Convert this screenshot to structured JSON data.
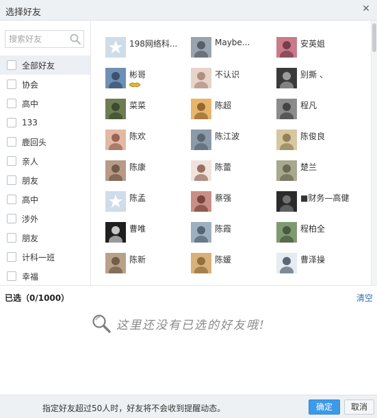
{
  "dialog": {
    "title": "选择好友",
    "close_glyph": "✕"
  },
  "search": {
    "placeholder": "搜索好友",
    "icon": "search-icon"
  },
  "groups": [
    {
      "label": "全部好友",
      "active": true
    },
    {
      "label": "协会"
    },
    {
      "label": "高中"
    },
    {
      "label": "133"
    },
    {
      "label": "鹿回头"
    },
    {
      "label": "亲人"
    },
    {
      "label": "朋友"
    },
    {
      "label": "高中"
    },
    {
      "label": "涉外"
    },
    {
      "label": "朋友"
    },
    {
      "label": "计科一班"
    },
    {
      "label": "幸福"
    }
  ],
  "friends": [
    {
      "name": "198网络科...",
      "avatar": "default-star-avatar"
    },
    {
      "name": "Maybe...",
      "avatar": "photo-avatar"
    },
    {
      "name": "安英姐",
      "avatar": "photo-avatar"
    },
    {
      "name": "彬哥",
      "avatar": "photo-avatar",
      "badge": "vip-badge"
    },
    {
      "name": "不认识",
      "avatar": "photo-avatar"
    },
    {
      "name": "别撕 、",
      "avatar": "photo-avatar"
    },
    {
      "name": "菜菜",
      "avatar": "photo-avatar"
    },
    {
      "name": "陈超",
      "avatar": "photo-avatar"
    },
    {
      "name": "程凡",
      "avatar": "photo-avatar"
    },
    {
      "name": "陈欢",
      "avatar": "photo-avatar"
    },
    {
      "name": "陈江波",
      "avatar": "photo-avatar"
    },
    {
      "name": "陈俊良",
      "avatar": "photo-avatar"
    },
    {
      "name": "陈康",
      "avatar": "photo-avatar"
    },
    {
      "name": "陈蕾",
      "avatar": "photo-avatar"
    },
    {
      "name": "楚兰",
      "avatar": "photo-avatar"
    },
    {
      "name": "陈孟",
      "avatar": "default-star-avatar"
    },
    {
      "name": "蔡强",
      "avatar": "photo-avatar"
    },
    {
      "name": "■财务—高健",
      "avatar": "photo-avatar"
    },
    {
      "name": "曹唯",
      "avatar": "photo-avatar"
    },
    {
      "name": "陈霞",
      "avatar": "photo-avatar"
    },
    {
      "name": "程柏全",
      "avatar": "photo-avatar"
    },
    {
      "name": "陈新",
      "avatar": "photo-avatar"
    },
    {
      "name": "陈媛",
      "avatar": "photo-avatar"
    },
    {
      "name": "曹泽操",
      "avatar": "photo-avatar"
    }
  ],
  "selected": {
    "label": "已选（0/1000）",
    "clear": "清空"
  },
  "empty": {
    "message": "这里还没有已选的好友哦!",
    "icon": "magnifier-icon"
  },
  "footer": {
    "note": "指定好友超过50人时，好友将不会收到提醒动态。",
    "ok": "确定",
    "cancel": "取消"
  },
  "colors": {
    "accent": "#3d9ae8",
    "link": "#2a6fb8",
    "bar": "#eef1f4"
  }
}
